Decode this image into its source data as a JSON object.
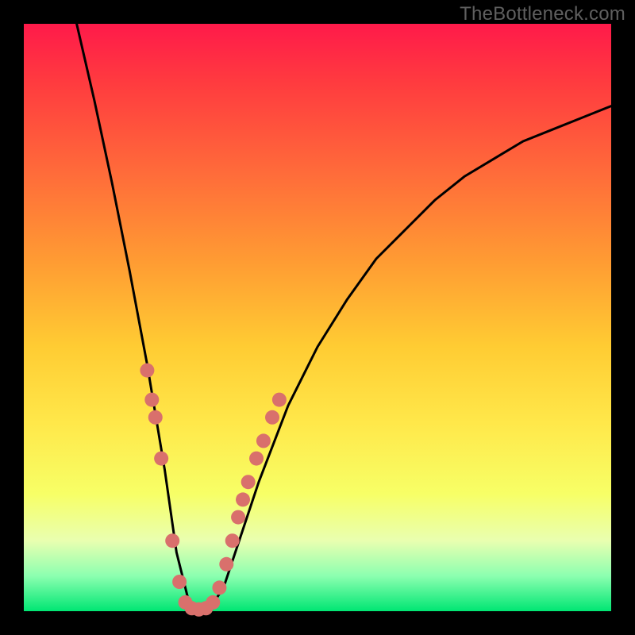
{
  "watermark": "TheBottleneck.com",
  "colors": {
    "frame": "#000000",
    "curve_stroke": "#000000",
    "dot_fill": "#d9706c",
    "gradient_top": "#ff1a4a",
    "gradient_bottom": "#00e673"
  },
  "chart_data": {
    "type": "line",
    "title": "",
    "xlabel": "",
    "ylabel": "",
    "xlim": [
      0,
      100
    ],
    "ylim": [
      0,
      100
    ],
    "series": [
      {
        "name": "bottleneck-curve",
        "note": "V-shaped bottleneck curve; values estimated from pixel positions. y ≈ 0 at valley floor near x ≈ 27–33.",
        "x": [
          9,
          12,
          15,
          18,
          21,
          24,
          26,
          28,
          30,
          32,
          34,
          36,
          40,
          45,
          50,
          55,
          60,
          65,
          70,
          75,
          80,
          85,
          90,
          95,
          100
        ],
        "y": [
          100,
          87,
          73,
          58,
          42,
          24,
          10,
          2,
          0,
          1,
          4,
          10,
          22,
          35,
          45,
          53,
          60,
          65,
          70,
          74,
          77,
          80,
          82,
          84,
          86
        ]
      }
    ],
    "markers": {
      "name": "highlight-dots",
      "note": "salmon-colored sample dots clustered near the valley on both branches",
      "points": [
        {
          "x": 21.0,
          "y": 41
        },
        {
          "x": 21.8,
          "y": 36
        },
        {
          "x": 22.4,
          "y": 33
        },
        {
          "x": 23.4,
          "y": 26
        },
        {
          "x": 25.3,
          "y": 12
        },
        {
          "x": 26.5,
          "y": 5
        },
        {
          "x": 27.5,
          "y": 1.5
        },
        {
          "x": 28.6,
          "y": 0.5
        },
        {
          "x": 29.8,
          "y": 0.3
        },
        {
          "x": 31.0,
          "y": 0.5
        },
        {
          "x": 32.2,
          "y": 1.5
        },
        {
          "x": 33.3,
          "y": 4
        },
        {
          "x": 34.5,
          "y": 8
        },
        {
          "x": 35.5,
          "y": 12
        },
        {
          "x": 36.5,
          "y": 16
        },
        {
          "x": 37.3,
          "y": 19
        },
        {
          "x": 38.2,
          "y": 22
        },
        {
          "x": 39.6,
          "y": 26
        },
        {
          "x": 40.8,
          "y": 29
        },
        {
          "x": 42.3,
          "y": 33
        },
        {
          "x": 43.5,
          "y": 36
        }
      ]
    }
  }
}
